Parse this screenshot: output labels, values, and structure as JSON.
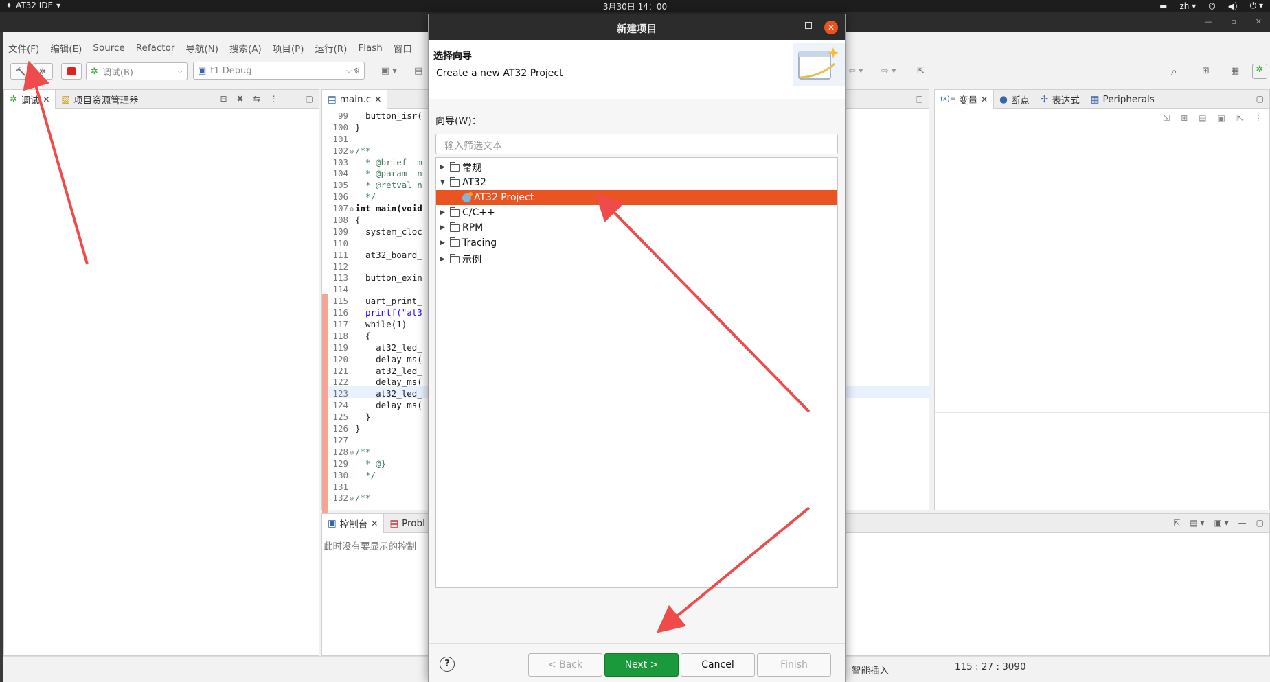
{
  "topbar": {
    "app_name": "AT32 IDE",
    "clock": "3月30日  14：00",
    "lang": "zh"
  },
  "menu": [
    "文件(F)",
    "编辑(E)",
    "Source",
    "Refactor",
    "导航(N)",
    "搜索(A)",
    "项目(P)",
    "运行(R)",
    "Flash",
    "窗口"
  ],
  "toolbar": {
    "debug_combo": "调试(B)",
    "config_combo": "t1 Debug"
  },
  "left_panel": {
    "tabs": [
      "调试",
      "项目资源管理器"
    ]
  },
  "editor": {
    "tab": "main.c",
    "lines": [
      {
        "n": "99",
        "f": "",
        "t": "  button_isr(",
        "c": "code"
      },
      {
        "n": "100",
        "f": "",
        "t": "}",
        "c": "code"
      },
      {
        "n": "101",
        "f": "",
        "t": "",
        "c": "code"
      },
      {
        "n": "102",
        "f": "⊖",
        "t": "/**",
        "c": "cm"
      },
      {
        "n": "103",
        "f": "",
        "t": "  * @brief  m",
        "c": "cm"
      },
      {
        "n": "104",
        "f": "",
        "t": "  * @param  n",
        "c": "cm"
      },
      {
        "n": "105",
        "f": "",
        "t": "  * @retval n",
        "c": "cm"
      },
      {
        "n": "106",
        "f": "",
        "t": "  */",
        "c": "cm"
      },
      {
        "n": "107",
        "f": "⊖",
        "t": "int main(void",
        "c": "kw"
      },
      {
        "n": "108",
        "f": "",
        "t": "{",
        "c": "code"
      },
      {
        "n": "109",
        "f": "",
        "t": "  system_cloc",
        "c": "code"
      },
      {
        "n": "110",
        "f": "",
        "t": "",
        "c": "code"
      },
      {
        "n": "111",
        "f": "",
        "t": "  at32_board_",
        "c": "code"
      },
      {
        "n": "112",
        "f": "",
        "t": "",
        "c": "code"
      },
      {
        "n": "113",
        "f": "",
        "t": "  button_exin",
        "c": "code"
      },
      {
        "n": "114",
        "f": "",
        "t": "",
        "c": "code"
      },
      {
        "n": "115",
        "f": "",
        "t": "  uart_print_",
        "c": "code"
      },
      {
        "n": "116",
        "f": "",
        "t": "  printf(\"at3",
        "c": "str"
      },
      {
        "n": "117",
        "f": "",
        "t": "  while(1)",
        "c": "code"
      },
      {
        "n": "118",
        "f": "",
        "t": "  {",
        "c": "code"
      },
      {
        "n": "119",
        "f": "",
        "t": "    at32_led_",
        "c": "code"
      },
      {
        "n": "120",
        "f": "",
        "t": "    delay_ms(",
        "c": "code"
      },
      {
        "n": "121",
        "f": "",
        "t": "    at32_led_",
        "c": "code"
      },
      {
        "n": "122",
        "f": "",
        "t": "    delay_ms(",
        "c": "code"
      },
      {
        "n": "123",
        "f": "",
        "t": "    at32_led_",
        "c": "code"
      },
      {
        "n": "124",
        "f": "",
        "t": "    delay_ms(",
        "c": "code"
      },
      {
        "n": "125",
        "f": "",
        "t": "  }",
        "c": "code"
      },
      {
        "n": "126",
        "f": "",
        "t": "}",
        "c": "code"
      },
      {
        "n": "127",
        "f": "",
        "t": "",
        "c": "code"
      },
      {
        "n": "128",
        "f": "⊖",
        "t": "/**",
        "c": "cm"
      },
      {
        "n": "129",
        "f": "",
        "t": "  * @}",
        "c": "cm"
      },
      {
        "n": "130",
        "f": "",
        "t": "  */",
        "c": "cm"
      },
      {
        "n": "131",
        "f": "",
        "t": "",
        "c": "code"
      },
      {
        "n": "132",
        "f": "⊖",
        "t": "/**",
        "c": "cm"
      }
    ]
  },
  "console": {
    "tabs": [
      "控制台",
      "Probl"
    ],
    "message": "此时没有要显示的控制"
  },
  "right_panel": {
    "tabs": [
      "变量",
      "断点",
      "表达式",
      "Peripherals"
    ]
  },
  "statusbar": {
    "insert_mode": "智能插入",
    "position": "115 : 27 : 3090"
  },
  "dialog": {
    "title": "新建项目",
    "header_title": "选择向导",
    "header_desc": "Create a new AT32 Project",
    "filter_label": "向导(W)：",
    "filter_placeholder": "输入筛选文本",
    "tree": [
      {
        "label": "常规",
        "expanded": false,
        "selected": false
      },
      {
        "label": "AT32",
        "expanded": true,
        "selected": false
      },
      {
        "label": "AT32 Project",
        "child": true,
        "selected": true
      },
      {
        "label": "C/C++",
        "expanded": false,
        "selected": false
      },
      {
        "label": "RPM",
        "expanded": false,
        "selected": false
      },
      {
        "label": "Tracing",
        "expanded": false,
        "selected": false
      },
      {
        "label": "示例",
        "expanded": false,
        "selected": false
      }
    ],
    "help": "?",
    "buttons": {
      "back": "< Back",
      "next": "Next >",
      "cancel": "Cancel",
      "finish": "Finish"
    }
  },
  "colors": {
    "selection": "#e95420",
    "next_button": "#1a9a3a",
    "arrow": "#ef4b4b"
  }
}
